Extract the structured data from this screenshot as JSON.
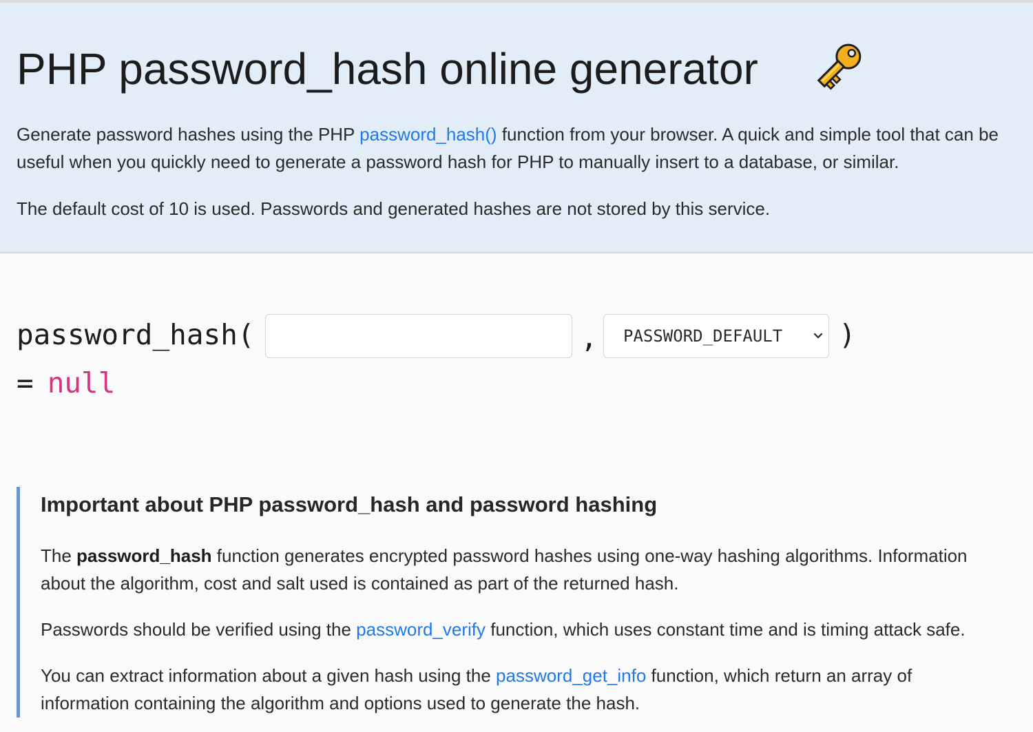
{
  "header": {
    "title": "PHP password_hash online generator",
    "icon": "key-icon",
    "description": {
      "before": "Generate password hashes using the PHP ",
      "link": "password_hash()",
      "after": " function from your browser. A quick and simple tool that can be useful when you quickly need to generate a password hash for PHP to manually insert to a database, or similar."
    },
    "note": "The default cost of 10 is used. Passwords and generated hashes are not stored by this service."
  },
  "generator": {
    "function_open": "password_hash(",
    "password_input_value": "",
    "separator": ",",
    "algorithm_selected": "PASSWORD_DEFAULT",
    "function_close": ")",
    "result_equals": "=",
    "result_value": "null"
  },
  "info": {
    "title": "Important about PHP password_hash and password hashing",
    "p1": {
      "before": "The ",
      "bold": "password_hash",
      "after": " function generates encrypted password hashes using one-way hashing algorithms. Information about the algorithm, cost and salt used is contained as part of the returned hash."
    },
    "p2": {
      "before": "Passwords should be verified using the ",
      "link": "password_verify",
      "after": " function, which uses constant time and is timing attack safe."
    },
    "p3": {
      "before": "You can extract information about a given hash using the ",
      "link": "password_get_info",
      "after": " function, which return an array of information containing the algorithm and options used to generate the hash."
    }
  },
  "colors": {
    "hero_background": "#e3edf8",
    "link": "#1f7ae8",
    "null_value": "#d63384",
    "info_border": "#6d96cf"
  }
}
